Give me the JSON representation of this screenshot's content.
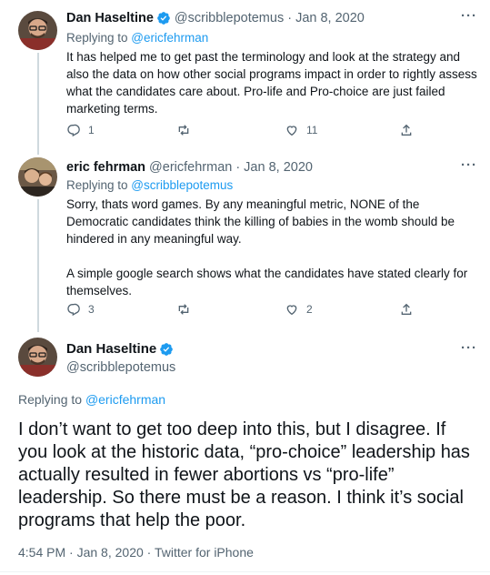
{
  "tweets": [
    {
      "name": "Dan Haseltine",
      "handle": "@scribblepotemus",
      "dot": "·",
      "date": "Jan 8, 2020",
      "replying_prefix": "Replying to ",
      "replying_to": "@ericfehrman",
      "paragraphs": [
        "It has helped me to get past the terminology and look at the strategy and also the data on how other social programs impact in order to rightly assess what the candidates care about.  Pro-life and Pro-choice are just failed marketing terms."
      ],
      "replies": "1",
      "retweets": "",
      "likes": "11"
    },
    {
      "name": "eric fehrman",
      "handle": "@ericfehrman",
      "dot": "·",
      "date": "Jan 8, 2020",
      "replying_prefix": "Replying to ",
      "replying_to": "@scribblepotemus",
      "paragraphs": [
        "Sorry, thats word games. By any meaningful metric, NONE of the Democratic candidates think the killing of babies in the womb should be hindered in any meaningful way.",
        "A simple google search shows what the candidates have stated clearly for themselves."
      ],
      "replies": "3",
      "retweets": "",
      "likes": "2"
    }
  ],
  "main": {
    "name": "Dan Haseltine",
    "handle": "@scribblepotemus",
    "replying_prefix": "Replying to ",
    "replying_to": "@ericfehrman",
    "text": "I don’t want to get too deep into this, but I disagree.  If you look at the historic data, “pro-choice” leadership has actually resulted in fewer abortions vs “pro-life” leadership.  So there must be a reason.  I think it’s social programs that help the poor.",
    "time": "4:54 PM",
    "dot1": "·",
    "date": "Jan 8, 2020",
    "dot2": "·",
    "source": "Twitter for iPhone"
  },
  "more_label": "···",
  "icons": {
    "verified": "verified-badge-icon",
    "reply": "reply-icon",
    "retweet": "retweet-icon",
    "like": "heart-icon",
    "share": "share-icon",
    "more": "more-icon"
  },
  "colors": {
    "accent": "#1d9bf0",
    "secondary_text": "#536471",
    "primary_text": "#0f1419",
    "thread_line": "#cfd9de"
  }
}
